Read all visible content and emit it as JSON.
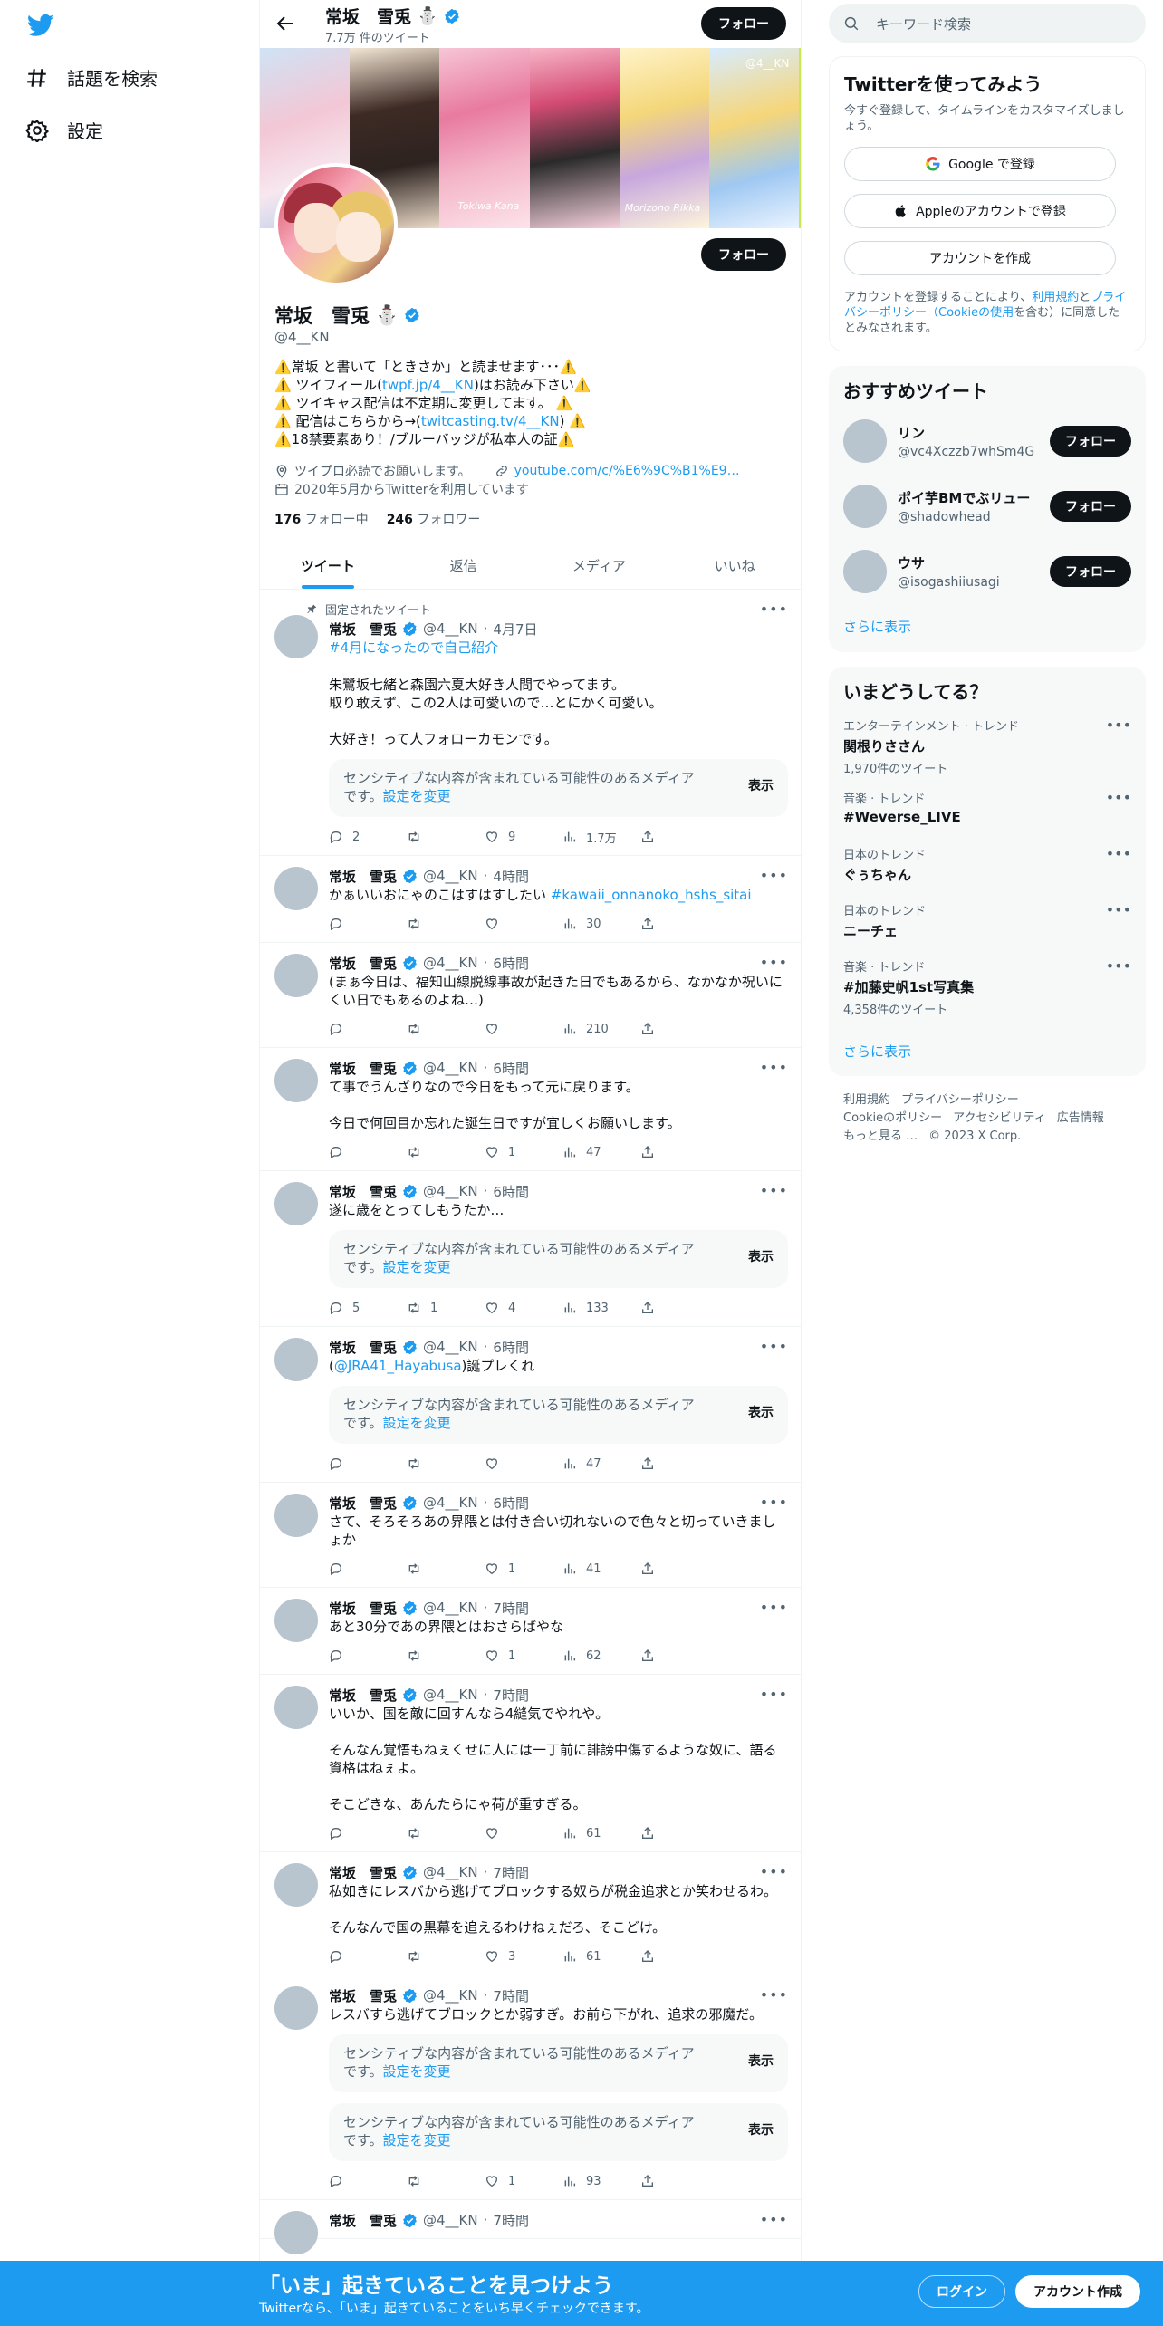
{
  "nav": {
    "explore_label": "話題を検索",
    "settings_label": "設定"
  },
  "profile": {
    "name": "常坂　雪兎",
    "emoji": "⛄",
    "tweet_count": "7.7万 件のツイート",
    "follow_label": "フォロー",
    "handle": "@4__KN",
    "bio_lines": [
      {
        "pre": "⚠️常坂 と書いて「ときさか」と読ませます･･･⚠️",
        "link": "",
        "post": ""
      },
      {
        "pre": "⚠️ ツイフィール(",
        "link": "twpf.jp/4__KN",
        "post": ")はお読み下さい⚠️"
      },
      {
        "pre": "⚠️ ツイキャス配信は不定期に変更してます。 ⚠️",
        "link": "",
        "post": ""
      },
      {
        "pre": "⚠️  配信はこちらから→(",
        "link": "twitcasting.tv/4__KN",
        "post": ") ⚠️"
      },
      {
        "pre": "⚠️18禁要素あり！/ブルーバッジが私本人の証⚠️",
        "link": "",
        "post": ""
      }
    ],
    "location": "ツイプロ必読でお願いします。",
    "url": "youtube.com/c/%E6%9C%B1%E9…",
    "joined": "2020年5月からTwitterを利用しています",
    "following_count": "176",
    "following_label": "フォロー中",
    "followers_count": "246",
    "followers_label": "フォロワー"
  },
  "banner": {
    "captions": [
      "Tokiwa Kana",
      "Morizono Rikka",
      "@4__KN"
    ]
  },
  "tabs": [
    "ツイート",
    "返信",
    "メディア",
    "いいね"
  ],
  "tweets": [
    {
      "pinned": "固定されたツイート",
      "name": "常坂　雪兎",
      "handle": "@4__KN",
      "time": "4月7日",
      "hashtag": "#4月になったので自己紹介",
      "text": "朱鷺坂七緒と森園六夏大好き人間でやってます。\n取り敢えず、この2人は可愛いので…とにかく可愛い。\n\n大好き！って人フォローカモンです。",
      "sensitive": 1,
      "replies": "2",
      "retweets": "",
      "likes": "9",
      "views": "1.7万"
    },
    {
      "pinned": "",
      "name": "常坂　雪兎",
      "handle": "@4__KN",
      "time": "4時間",
      "text": "かぁいいおにゃのこはすはすしたい",
      "tag_inline": "#kawaii_onnanoko_hshs_sitai",
      "sensitive": 0,
      "replies": "",
      "retweets": "",
      "likes": "",
      "views": "30"
    },
    {
      "pinned": "",
      "name": "常坂　雪兎",
      "handle": "@4__KN",
      "time": "6時間",
      "text": "(まぁ今日は、福知山線脱線事故が起きた日でもあるから、なかなか祝いにくい日でもあるのよね…)",
      "sensitive": 0,
      "replies": "",
      "retweets": "",
      "likes": "",
      "views": "210"
    },
    {
      "pinned": "",
      "name": "常坂　雪兎",
      "handle": "@4__KN",
      "time": "6時間",
      "text": "て事でうんざりなので今日をもって元に戻ります。\n\n今日で何回目か忘れた誕生日ですが宜しくお願いします。",
      "sensitive": 0,
      "replies": "",
      "retweets": "",
      "likes": "1",
      "views": "47"
    },
    {
      "pinned": "",
      "name": "常坂　雪兎",
      "handle": "@4__KN",
      "time": "6時間",
      "text": "遂に歳をとってしもうたか…",
      "sensitive": 1,
      "replies": "5",
      "retweets": "1",
      "likes": "4",
      "views": "133"
    },
    {
      "pinned": "",
      "name": "常坂　雪兎",
      "handle": "@4__KN",
      "time": "6時間",
      "mention": "@JRA41_Hayabusa",
      "text": ")誕プレくれ",
      "sensitive": 1,
      "replies": "",
      "retweets": "",
      "likes": "",
      "views": "47"
    },
    {
      "pinned": "",
      "name": "常坂　雪兎",
      "handle": "@4__KN",
      "time": "6時間",
      "text": "さて、そろそろあの界隈とは付き合い切れないので色々と切っていきましょか",
      "sensitive": 0,
      "replies": "",
      "retweets": "",
      "likes": "1",
      "views": "41"
    },
    {
      "pinned": "",
      "name": "常坂　雪兎",
      "handle": "@4__KN",
      "time": "7時間",
      "text": "あと30分であの界隈とはおさらばやな",
      "sensitive": 0,
      "replies": "",
      "retweets": "",
      "likes": "1",
      "views": "62"
    },
    {
      "pinned": "",
      "name": "常坂　雪兎",
      "handle": "@4__KN",
      "time": "7時間",
      "text": "いいか、国を敵に回すんなら4縫気でやれや。\n\nそんなん覚悟もねぇくせに人には一丁前に誹謗中傷するような奴に、語る資格はねぇよ。\n\nそこどきな、あんたらにゃ荷が重すぎる。",
      "sensitive": 0,
      "replies": "",
      "retweets": "",
      "likes": "",
      "views": "61"
    },
    {
      "pinned": "",
      "name": "常坂　雪兎",
      "handle": "@4__KN",
      "time": "7時間",
      "text": "私如きにレスバから逃げてブロックする奴らが税金追求とか笑わせるわ。\n\nそんなんで国の黒幕を追えるわけねぇだろ、そこどけ。",
      "sensitive": 0,
      "replies": "",
      "retweets": "",
      "likes": "3",
      "views": "61"
    },
    {
      "pinned": "",
      "name": "常坂　雪兎",
      "handle": "@4__KN",
      "time": "7時間",
      "text": "レスバすら逃げてブロックとか弱すぎ。お前ら下がれ、追求の邪魔だ。",
      "sensitive": 2,
      "replies": "",
      "retweets": "",
      "likes": "1",
      "views": "93"
    },
    {
      "pinned": "",
      "name": "常坂　雪兎",
      "handle": "@4__KN",
      "time": "7時間",
      "text": "",
      "sensitive": 0,
      "replies": "",
      "retweets": "",
      "likes": "",
      "views": ""
    }
  ],
  "sensitive": {
    "text": "センシティブな内容が含まれている可能性のあるメディアです。",
    "link": "設定を変更",
    "show": "表示"
  },
  "search": {
    "placeholder": "キーワード検索"
  },
  "signup_card": {
    "title": "Twitterを使ってみよう",
    "desc": "今すぐ登録して、タイムラインをカスタマイズしましょう。",
    "google": "Google で登録",
    "apple": "Appleのアカウントで登録",
    "create": "アカウントを作成",
    "terms_pre": "アカウントを登録することにより、",
    "terms_link1": "利用規約",
    "terms_mid": "と",
    "terms_link2": "プライバシーポリシー（Cookieの使用",
    "terms_post": "を含む）に同意したとみなされます。"
  },
  "recommended": {
    "title": "おすすめツイート",
    "users": [
      {
        "name": "リン",
        "handle": "@vc4Xczzb7whSm4G"
      },
      {
        "name": "ポイ芋BMでぶリュー",
        "handle": "@shadowhead"
      },
      {
        "name": "ウサ",
        "handle": "@isogashiiusagi"
      }
    ],
    "follow_label": "フォロー",
    "more": "さらに表示"
  },
  "trends": {
    "title": "いまどうしてる？",
    "items": [
      {
        "context": "エンターテインメント · トレンド",
        "topic": "関根りささん",
        "count": "1,970件のツイート"
      },
      {
        "context": "音楽 · トレンド",
        "topic": "#Weverse_LIVE",
        "count": ""
      },
      {
        "context": "日本のトレンド",
        "topic": "ぐぅちゃん",
        "count": ""
      },
      {
        "context": "日本のトレンド",
        "topic": "ニーチェ",
        "count": ""
      },
      {
        "context": "音楽 · トレンド",
        "topic": "#加藤史帆1st写真集",
        "count": "4,358件のツイート"
      }
    ],
    "more": "さらに表示"
  },
  "footer": {
    "links": [
      "利用規約",
      "プライバシーポリシー",
      "Cookieのポリシー",
      "アクセシビリティ",
      "広告情報",
      "もっと見る …",
      "© 2023 X Corp."
    ]
  },
  "bottom_bar": {
    "title": "「いま」起きていることを見つけよう",
    "subtitle": "Twitterなら、「いま」起きていることをいち早くチェックできます。",
    "login": "ログイン",
    "signup": "アカウント作成"
  },
  "colors": {
    "accent": "#1d9bf0",
    "text": "#0f1419",
    "muted": "#536471"
  }
}
